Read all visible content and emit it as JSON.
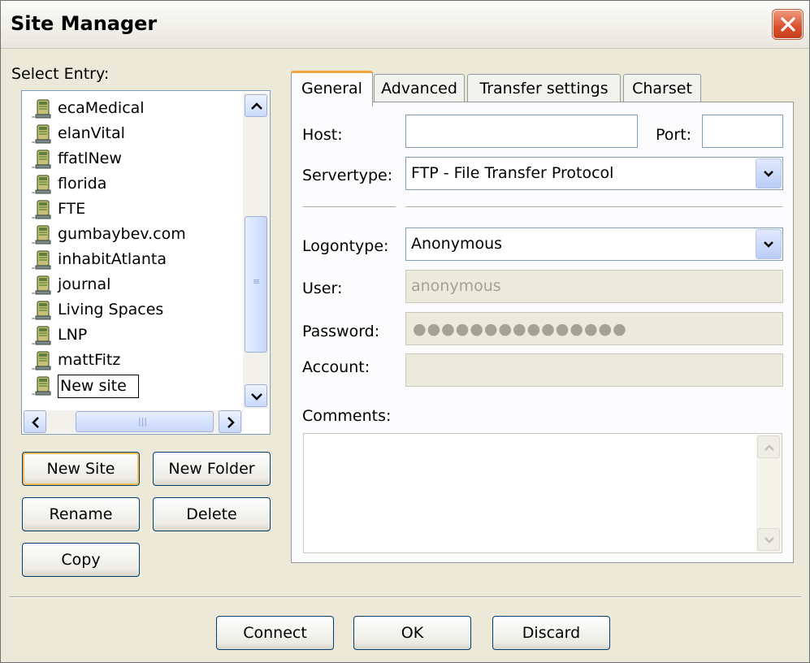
{
  "window": {
    "title": "Site Manager"
  },
  "select_entry_label": "Select Entry:",
  "sites": [
    {
      "name": "ecaMedical"
    },
    {
      "name": "elanVital"
    },
    {
      "name": "ffatlNew"
    },
    {
      "name": "florida"
    },
    {
      "name": "FTE"
    },
    {
      "name": "gumbaybev.com"
    },
    {
      "name": "inhabitAtlanta"
    },
    {
      "name": "journal"
    },
    {
      "name": "Living Spaces"
    },
    {
      "name": "LNP"
    },
    {
      "name": "mattFitz"
    },
    {
      "name": "New site",
      "selected": true
    }
  ],
  "left_buttons": {
    "new_site": "New Site",
    "new_folder": "New Folder",
    "rename": "Rename",
    "delete": "Delete",
    "copy": "Copy"
  },
  "tabs": [
    {
      "label": "General",
      "active": true
    },
    {
      "label": "Advanced"
    },
    {
      "label": "Transfer settings"
    },
    {
      "label": "Charset"
    }
  ],
  "general": {
    "host_label": "Host:",
    "host_value": "",
    "port_label": "Port:",
    "port_value": "",
    "servertype_label": "Servertype:",
    "servertype_value": "FTP - File Transfer Protocol",
    "logontype_label": "Logontype:",
    "logontype_value": "Anonymous",
    "user_label": "User:",
    "user_value": "anonymous",
    "password_label": "Password:",
    "password_value": "●●●●●●●●●●●●●●●",
    "account_label": "Account:",
    "account_value": "",
    "comments_label": "Comments:",
    "comments_value": ""
  },
  "bottom_buttons": {
    "connect": "Connect",
    "ok": "OK",
    "discard": "Discard"
  },
  "colors": {
    "dialog_bg": "#ece9d8",
    "close_button": "#d9512c",
    "active_tab_accent": "#f2a33a",
    "default_button_focus": "#f5bf4f"
  }
}
